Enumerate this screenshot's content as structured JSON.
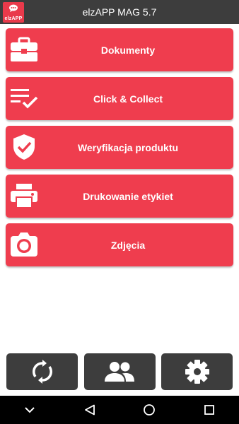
{
  "app": {
    "title": "elzAPP MAG 5.7",
    "logo_text": "elzAPP"
  },
  "menu": {
    "items": [
      {
        "label": "Dokumenty",
        "icon": "briefcase-icon"
      },
      {
        "label": "Click & Collect",
        "icon": "checklist-icon"
      },
      {
        "label": "Weryfikacja produktu",
        "icon": "shield-check-icon"
      },
      {
        "label": "Drukowanie etykiet",
        "icon": "printer-icon"
      },
      {
        "label": "Zdjęcia",
        "icon": "camera-icon"
      }
    ]
  },
  "bottom_buttons": [
    {
      "icon": "sync-icon"
    },
    {
      "icon": "users-icon"
    },
    {
      "icon": "gear-icon"
    }
  ],
  "navbar": {
    "items": [
      "chevron-down-icon",
      "back-icon",
      "home-icon",
      "recents-icon"
    ]
  },
  "colors": {
    "accent": "#ef3d4e",
    "dark": "#3d3d3d",
    "navbar": "#000000"
  }
}
